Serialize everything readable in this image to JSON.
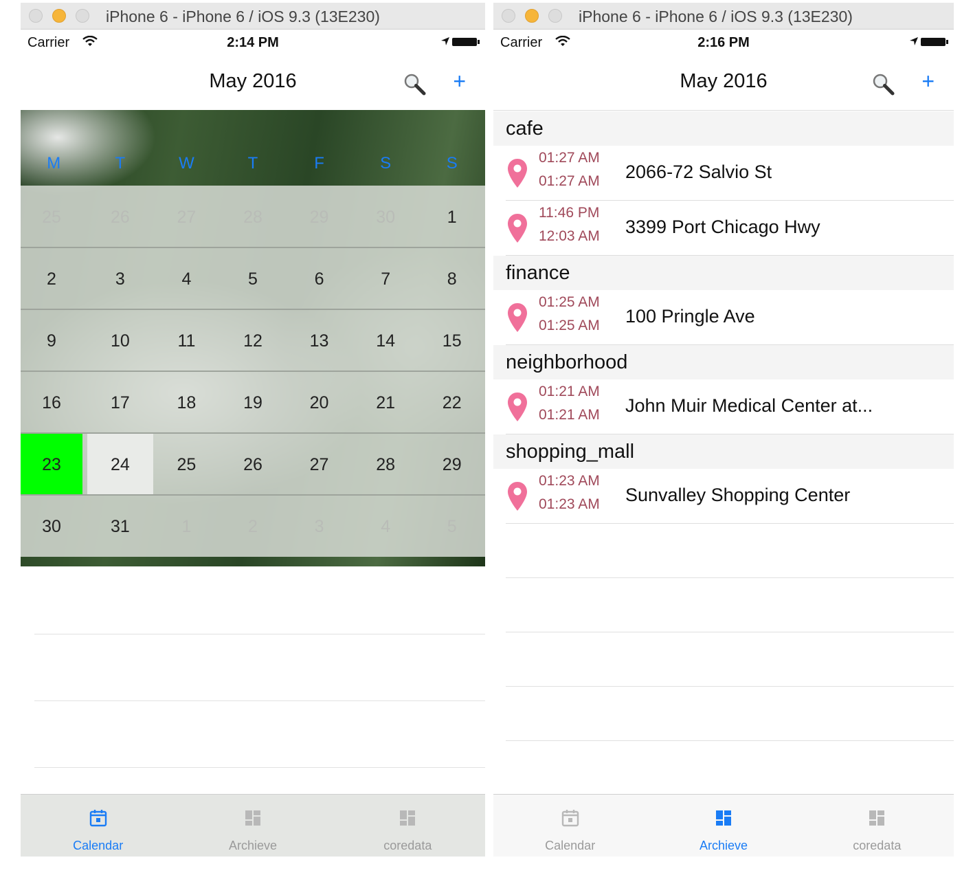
{
  "left": {
    "window_title": "iPhone 6 - iPhone 6 / iOS 9.3 (13E230)",
    "status": {
      "carrier": "Carrier",
      "time": "2:14 PM"
    },
    "nav": {
      "title": "May 2016",
      "add": "+"
    },
    "weekdays": [
      "M",
      "T",
      "W",
      "T",
      "F",
      "S",
      "S"
    ],
    "weeks": [
      [
        "25",
        "26",
        "27",
        "28",
        "29",
        "30",
        "1"
      ],
      [
        "2",
        "3",
        "4",
        "5",
        "6",
        "7",
        "8"
      ],
      [
        "9",
        "10",
        "11",
        "12",
        "13",
        "14",
        "15"
      ],
      [
        "16",
        "17",
        "18",
        "19",
        "20",
        "21",
        "22"
      ],
      [
        "23",
        "24",
        "25",
        "26",
        "27",
        "28",
        "29"
      ],
      [
        "30",
        "31",
        "1",
        "2",
        "3",
        "4",
        "5"
      ]
    ],
    "selected_day": "23",
    "selected_color": "#00ff00",
    "tabs": [
      {
        "label": "Calendar",
        "icon": "calendar-icon",
        "active": true
      },
      {
        "label": "Archieve",
        "icon": "dashboard-icon",
        "active": false
      },
      {
        "label": "coredata",
        "icon": "dashboard-icon",
        "active": false
      }
    ]
  },
  "right": {
    "window_title": "iPhone 6 - iPhone 6 / iOS 9.3 (13E230)",
    "status": {
      "carrier": "Carrier",
      "time": "2:16 PM"
    },
    "nav": {
      "title": "May 2016",
      "add": "+"
    },
    "sections": [
      {
        "title": "cafe",
        "items": [
          {
            "start": "01:27 AM",
            "end": "01:27 AM",
            "address": "2066-72 Salvio St"
          },
          {
            "start": "11:46 PM",
            "end": "12:03 AM",
            "address": "3399 Port Chicago Hwy"
          }
        ]
      },
      {
        "title": "finance",
        "items": [
          {
            "start": "01:25 AM",
            "end": "01:25 AM",
            "address": "100 Pringle Ave"
          }
        ]
      },
      {
        "title": "neighborhood",
        "items": [
          {
            "start": "01:21 AM",
            "end": "01:21 AM",
            "address": "John Muir Medical Center at..."
          }
        ]
      },
      {
        "title": "shopping_mall",
        "items": [
          {
            "start": "01:23 AM",
            "end": "01:23 AM",
            "address": "Sunvalley Shopping Center"
          }
        ]
      }
    ],
    "pin_color": "#f0709a",
    "tabs": [
      {
        "label": "Calendar",
        "icon": "calendar-icon",
        "active": false
      },
      {
        "label": "Archieve",
        "icon": "dashboard-icon",
        "active": true
      },
      {
        "label": "coredata",
        "icon": "dashboard-icon",
        "active": false
      }
    ]
  },
  "colors": {
    "accent": "#1a7cf5",
    "time_text": "#a0495a"
  }
}
